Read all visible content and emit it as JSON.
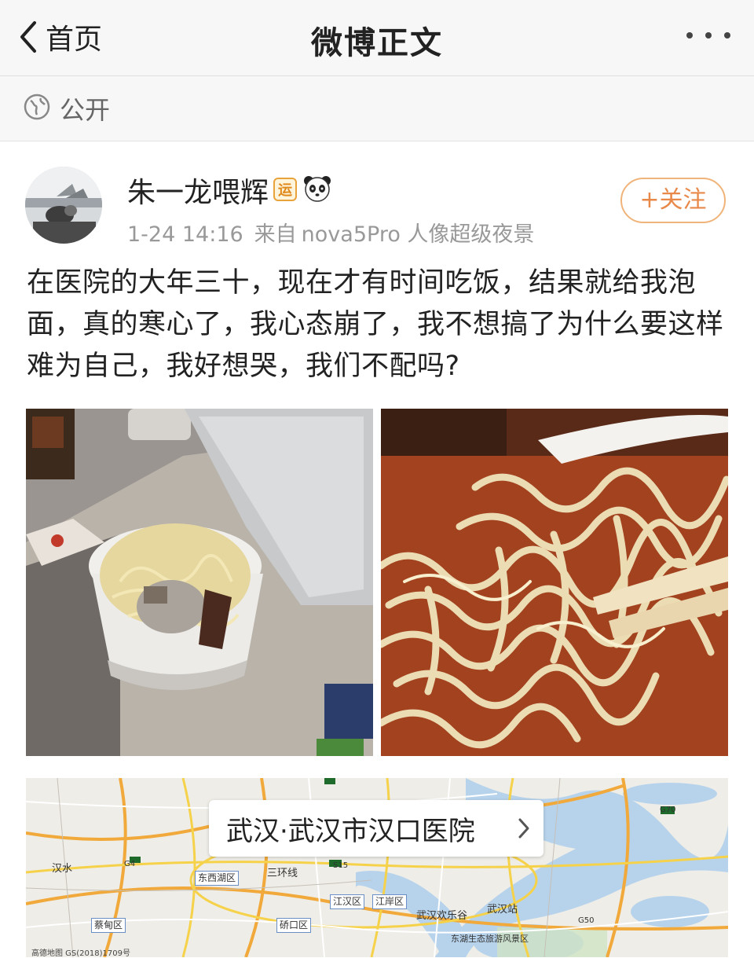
{
  "nav": {
    "back_label": "首页",
    "title": "微博正文",
    "back_icon": "chevron-left-icon",
    "more_icon": "more-dots-icon"
  },
  "visibility": {
    "icon": "globe-icon",
    "label": "公开"
  },
  "post": {
    "author": "朱一龙喂辉",
    "badge": "运",
    "badge_icon": "panda-emoji-icon",
    "time": "1-24 14:16",
    "source_prefix": "来自",
    "source": "nova5Pro 人像超级夜景",
    "follow_label": "+关注",
    "text": "在医院的大年三十，现在才有时间吃饭，结果就给我泡面，真的寒心了，我心态崩了，我不想搞了为什么要这样难为自己，我好想哭，我们不配吗?"
  },
  "location": {
    "label": "武汉·武汉市汉口医院",
    "chevron_icon": "chevron-right-icon"
  },
  "map": {
    "labels": [
      "三环线",
      "东西湖区",
      "江汉区",
      "江岸区",
      "硚口区",
      "蔡甸区",
      "武汉欢乐谷",
      "武汉站",
      "东湖生态旅游风景区",
      "汉水",
      "G70",
      "S15",
      "G4",
      "G50"
    ],
    "footer": "高德地图 GS(2018)1709号"
  },
  "colors": {
    "nav_bg": "#f7f7f7",
    "follow_accent": "#e8894a",
    "meta_gray": "#999999"
  }
}
